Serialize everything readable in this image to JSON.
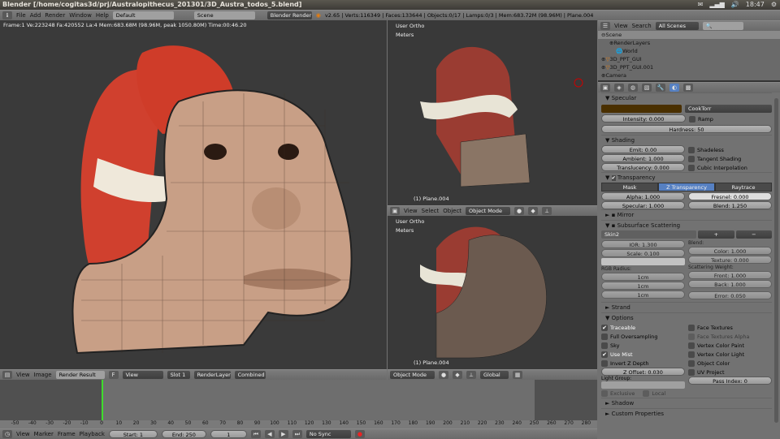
{
  "os": {
    "title": "Blender [/home/cogitas3d/prj/Australopithecus_201301/3D_Austra_todos_5.blend]",
    "time": "18:47"
  },
  "info": {
    "menus": [
      "File",
      "Add",
      "Render",
      "Window",
      "Help"
    ],
    "screen": "Default",
    "scene": "Scene",
    "engine": "Blender Render",
    "stats": "v2.65 | Verts:116349 | Faces:133644 | Objects:0/17 | Lamps:0/3 | Mem:683.72M (98.96M) | Plane.004"
  },
  "image_editor": {
    "render_stats": "Frame:1 Ve:223248 Fa:420552 La:4 Mem:683.68M (98.96M, peak 1050.80M) Time:00:46.20",
    "menus": [
      "View",
      "Image"
    ],
    "image": "Render Result",
    "f_label": "F",
    "view": "View",
    "slot": "Slot 1",
    "layer": "RenderLayer",
    "pass": "Combined"
  },
  "viewport_top": {
    "view": "User Ortho",
    "units": "Meters",
    "object": "(1) Plane.004",
    "menus": [
      "View",
      "Select",
      "Object"
    ],
    "mode": "Object Mode"
  },
  "viewport_bottom": {
    "view": "User Ortho",
    "units": "Meters",
    "object": "(1) Plane.004",
    "mode": "Object Mode",
    "orientation": "Global"
  },
  "timeline": {
    "ticks": [
      "-50",
      "-40",
      "-30",
      "-20",
      "-10",
      "0",
      "10",
      "20",
      "30",
      "40",
      "50",
      "60",
      "70",
      "80",
      "90",
      "100",
      "110",
      "120",
      "130",
      "140",
      "150",
      "160",
      "170",
      "180",
      "190",
      "200",
      "210",
      "220",
      "230",
      "240",
      "250",
      "260",
      "270",
      "280"
    ],
    "current_frame": 1,
    "menus": [
      "View",
      "Marker",
      "Frame",
      "Playback"
    ],
    "start": "Start: 1",
    "end": "End: 250",
    "frame": "1",
    "sync": "No Sync"
  },
  "outliner": {
    "menus": [
      "View",
      "Search"
    ],
    "filter": "All Scenes",
    "items": [
      "Scene",
      "RenderLayers",
      "World",
      "3D_PPT_GUI",
      "3D_PPT_GUI.001",
      "Camera"
    ]
  },
  "properties": {
    "specular": {
      "title": "Specular",
      "color": "#4a3000",
      "shader": "CookTorr",
      "intensity": "Intensity: 0.000",
      "ramp": "Ramp",
      "hardness": "Hardness: 50"
    },
    "shading": {
      "title": "Shading",
      "emit": "Emit: 0.00",
      "ambient": "Ambient: 1.000",
      "translucency": "Translucency: 0.000",
      "shadeless": "Shadeless",
      "tangent": "Tangent Shading",
      "cubic": "Cubic Interpolation"
    },
    "transparency": {
      "title": "Transparency",
      "modes": [
        "Mask",
        "Z Transparency",
        "Raytrace"
      ],
      "alpha": "Alpha: 1.000",
      "specular": "Specular: 1.000",
      "fresnel": "Fresnel: 0.000",
      "blend": "Blend: 1.250"
    },
    "mirror": "Mirror",
    "sss": {
      "title": "Subsurface Scattering",
      "preset": "Skin2",
      "ior": "IOR: 1.300",
      "scale": "Scale: 0.100",
      "blend_label": "Blend:",
      "color": "Color: 1.000",
      "texture": "Texture: 0.000",
      "rgb_label": "RGB Radius:",
      "radius": [
        "1cm",
        "1cm",
        "1cm"
      ],
      "weight_label": "Scattering Weight:",
      "front": "Front: 1.000",
      "back": "Back: 1.000",
      "error": "Error: 0.050"
    },
    "strand": "Strand",
    "options": {
      "title": "Options",
      "left": [
        {
          "label": "Traceable",
          "checked": true
        },
        {
          "label": "Full Oversampling",
          "checked": false
        },
        {
          "label": "Sky",
          "checked": false
        },
        {
          "label": "Use Mist",
          "checked": true
        },
        {
          "label": "Invert Z Depth",
          "checked": false
        }
      ],
      "right": [
        {
          "label": "Face Textures",
          "checked": false
        },
        {
          "label": "Face Textures Alpha",
          "checked": false
        },
        {
          "label": "Vertex Color Paint",
          "checked": false
        },
        {
          "label": "Vertex Color Light",
          "checked": false
        },
        {
          "label": "Object Color",
          "checked": false
        },
        {
          "label": "UV Project",
          "checked": false
        }
      ],
      "z_offset": "Z Offset: 0.030",
      "light_group": "Light Group:",
      "exclusive": "Exclusive",
      "local": "Local",
      "pass_index": "Pass Index: 0"
    },
    "shadow": "Shadow",
    "custom": "Custom Properties"
  }
}
